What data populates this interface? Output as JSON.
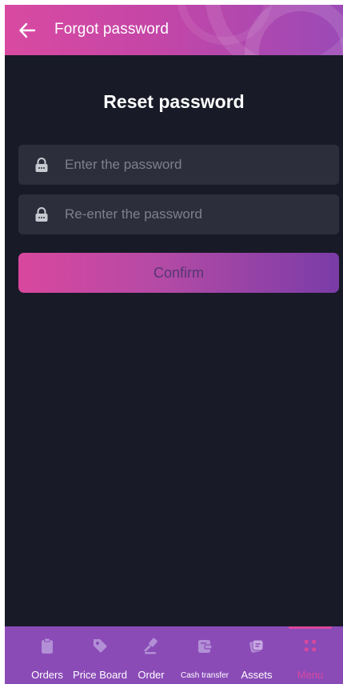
{
  "header": {
    "title": "Forgot password",
    "background_gradient": [
      "#d94aa1",
      "#9b4ab7"
    ]
  },
  "main": {
    "title": "Reset password",
    "password_field": {
      "placeholder": "Enter the password",
      "value": "",
      "icon": "lock-icon"
    },
    "confirm_password_field": {
      "placeholder": "Re-enter the password",
      "value": "",
      "icon": "lock-icon"
    },
    "confirm_button": {
      "label": "Confirm"
    }
  },
  "bottom_nav": {
    "items": [
      {
        "label": "Orders",
        "icon": "clipboard-icon",
        "active": false
      },
      {
        "label": "Price Board",
        "icon": "tag-icon",
        "active": false
      },
      {
        "label": "Order",
        "icon": "gavel-icon",
        "active": false
      },
      {
        "label": "Cash transfer",
        "icon": "wallet-icon",
        "active": false
      },
      {
        "label": "Assets",
        "icon": "assets-icon",
        "active": false
      },
      {
        "label": "Menu",
        "icon": "grid-icon",
        "active": true
      }
    ],
    "active_color": "#d9489e"
  },
  "colors": {
    "background": "#181a27",
    "field_background": "#2c2e3b",
    "nav_background": "#8a4bb7",
    "accent": "#d9489e"
  }
}
